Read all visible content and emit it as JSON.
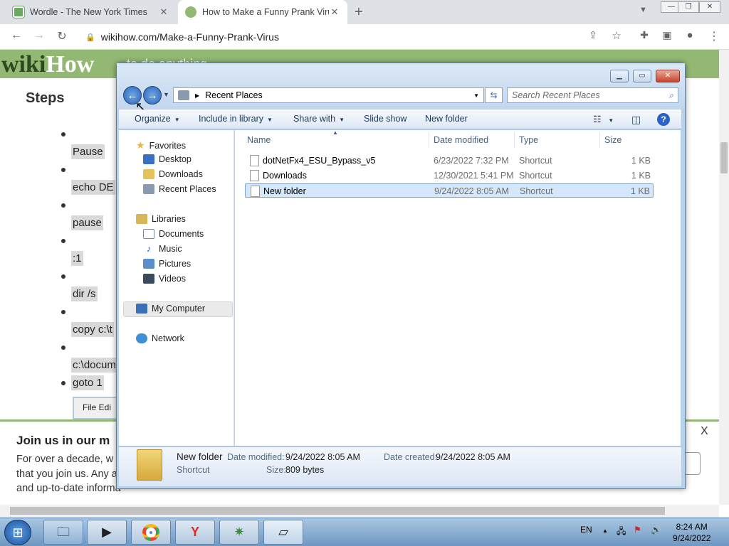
{
  "browser": {
    "tabs": [
      {
        "title": "Wordle - The New York Times",
        "favicon_color": "#6aaa64"
      },
      {
        "title": "How to Make a Funny Prank Virus",
        "favicon_color": "#93b874"
      }
    ],
    "new_tab": "+",
    "url": "wikihow.com/Make-a-Funny-Prank-Virus"
  },
  "wikihow": {
    "logo_wiki": "wiki",
    "logo_how": "How",
    "tagline": "to do anything",
    "steps_heading": "Steps",
    "code_lines": [
      "Pause",
      "echo DE",
      "pause",
      ":1",
      "dir /s",
      "copy c:\\t",
      "c:\\docum",
      "goto 1"
    ],
    "notepad_menu": "File  Edi",
    "banner": {
      "title": "Join us in our m",
      "text_1": "For over a decade, w",
      "text_2": "that you join us. Any a",
      "text_3": "and up-to-date informa",
      "close": "X"
    }
  },
  "explorer": {
    "address": "Recent Places",
    "search_placeholder": "Search Recent Places",
    "commands": {
      "organize": "Organize",
      "include": "Include in library",
      "share": "Share with",
      "slideshow": "Slide show",
      "new_folder": "New folder"
    },
    "nav": {
      "favorites": "Favorites",
      "desktop": "Desktop",
      "downloads": "Downloads",
      "recent": "Recent Places",
      "libraries": "Libraries",
      "documents": "Documents",
      "music": "Music",
      "pictures": "Pictures",
      "videos": "Videos",
      "computer": "My Computer",
      "network": "Network"
    },
    "columns": {
      "name": "Name",
      "date": "Date modified",
      "type": "Type",
      "size": "Size"
    },
    "files": [
      {
        "name": "dotNetFx4_ESU_Bypass_v5",
        "date": "6/23/2022 7:32 PM",
        "type": "Shortcut",
        "size": "1 KB"
      },
      {
        "name": "Downloads",
        "date": "12/30/2021 5:41 PM",
        "type": "Shortcut",
        "size": "1 KB"
      },
      {
        "name": "New folder",
        "date": "9/24/2022 8:05 AM",
        "type": "Shortcut",
        "size": "1 KB"
      }
    ],
    "details": {
      "name": "New folder",
      "type": "Shortcut",
      "modified_label": "Date modified:",
      "modified": "9/24/2022 8:05 AM",
      "created_label": "Date created:",
      "created": "9/24/2022 8:05 AM",
      "size_label": "Size:",
      "size": "809 bytes"
    }
  },
  "taskbar": {
    "lang": "EN",
    "time": "8:24 AM",
    "date": "9/24/2022"
  }
}
